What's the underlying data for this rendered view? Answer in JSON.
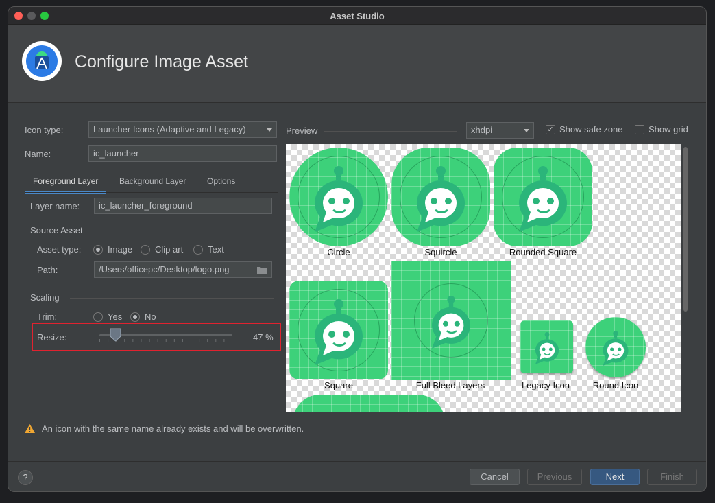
{
  "window": {
    "title": "Asset Studio"
  },
  "header": {
    "title": "Configure Image Asset"
  },
  "form": {
    "icon_type_label": "Icon type:",
    "icon_type_value": "Launcher Icons (Adaptive and Legacy)",
    "name_label": "Name:",
    "name_value": "ic_launcher"
  },
  "tabs": [
    {
      "label": "Foreground Layer",
      "active": true
    },
    {
      "label": "Background Layer",
      "active": false
    },
    {
      "label": "Options",
      "active": false
    }
  ],
  "layer": {
    "name_label": "Layer name:",
    "name_value": "ic_launcher_foreground"
  },
  "source": {
    "section_title": "Source Asset",
    "asset_type_label": "Asset type:",
    "options": [
      "Image",
      "Clip art",
      "Text"
    ],
    "selected": "Image",
    "path_label": "Path:",
    "path_value": "/Users/officepc/Desktop/logo.png"
  },
  "scaling": {
    "section_title": "Scaling",
    "trim_label": "Trim:",
    "trim_yes": "Yes",
    "trim_no": "No",
    "trim_selected": "No",
    "resize_label": "Resize:",
    "resize_value": "47 %",
    "resize_percent": 47
  },
  "preview": {
    "label": "Preview",
    "density": "xhdpi",
    "show_safe_zone": "Show safe zone",
    "show_safe_zone_checked": true,
    "show_grid": "Show grid",
    "show_grid_checked": false,
    "captions": [
      "Circle",
      "Squircle",
      "Rounded Square",
      "Square",
      "Full Bleed Layers",
      "Legacy Icon",
      "Round Icon"
    ]
  },
  "warning": "An icon with the same name already exists and will be overwritten.",
  "buttons": {
    "help": "?",
    "cancel": "Cancel",
    "previous": "Previous",
    "next": "Next",
    "finish": "Finish"
  },
  "colors": {
    "accent": "#4a88c7",
    "icon_green": "#3dd17a",
    "highlight": "#e0222f",
    "next_button": "#365880"
  }
}
